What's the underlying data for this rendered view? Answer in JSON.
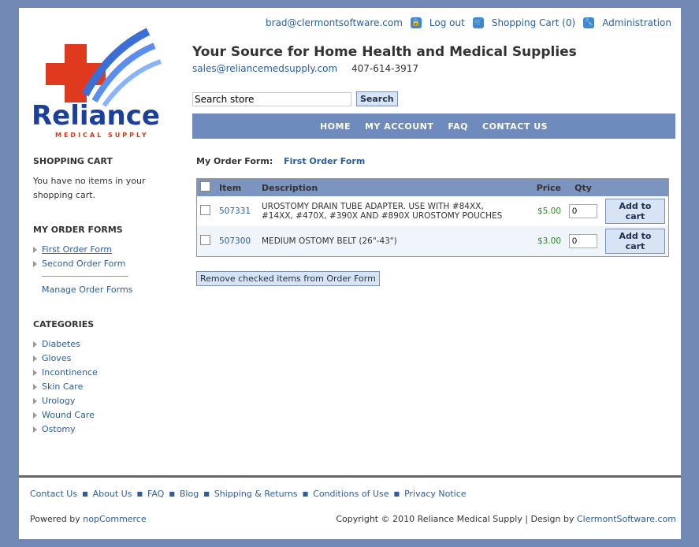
{
  "header": {
    "email": "brad@clermontsoftware.com",
    "logout": "Log out",
    "cart": "Shopping Cart (0)",
    "admin": "Administration",
    "tagline": "Your Source for Home Health and Medical Supplies",
    "sales_email": "sales@reliancemedsupply.com",
    "phone": "407-614-3917",
    "logo_text": "Reliance",
    "logo_sub": "MEDICAL SUPPLY"
  },
  "search": {
    "value": "Search store",
    "button": "Search"
  },
  "nav": [
    "HOME",
    "MY ACCOUNT",
    "FAQ",
    "CONTACT US"
  ],
  "sidebar": {
    "cart_title": "SHOPPING CART",
    "cart_text": "You have no items in your shopping cart.",
    "forms_title": "MY ORDER FORMS",
    "forms": [
      "First Order Form",
      "Second Order Form"
    ],
    "manage": "Manage Order Forms",
    "categories_title": "CATEGORIES",
    "categories": [
      "Diabetes",
      "Gloves",
      "Incontinence",
      "Skin Care",
      "Urology",
      "Wound Care",
      "Ostomy"
    ]
  },
  "main": {
    "label": "My Order Form:",
    "form_name": "First Order Form",
    "columns": {
      "item": "Item",
      "description": "Description",
      "price": "Price",
      "qty": "Qty"
    },
    "rows": [
      {
        "item": "507331",
        "description": "UROSTOMY DRAIN TUBE ADAPTER. USE WITH #84XX, #14XX, #470X, #390X AND #890X UROSTOMY POUCHES",
        "price": "$5.00",
        "qty": "0",
        "button": "Add to cart"
      },
      {
        "item": "507300",
        "description": "MEDIUM OSTOMY BELT (26\"-43\")",
        "price": "$3.00",
        "qty": "0",
        "button": "Add to cart"
      }
    ],
    "remove_button": "Remove checked items from Order Form"
  },
  "footer": {
    "links": [
      "Contact Us",
      "About Us",
      "FAQ",
      "Blog",
      "Shipping & Returns",
      "Conditions of Use",
      "Privacy Notice"
    ],
    "powered_prefix": "Powered by",
    "powered_link": "nopCommerce",
    "copyright": "Copyright © 2010 Reliance Medical Supply | Design by",
    "design_link": "ClermontSoftware.com"
  }
}
